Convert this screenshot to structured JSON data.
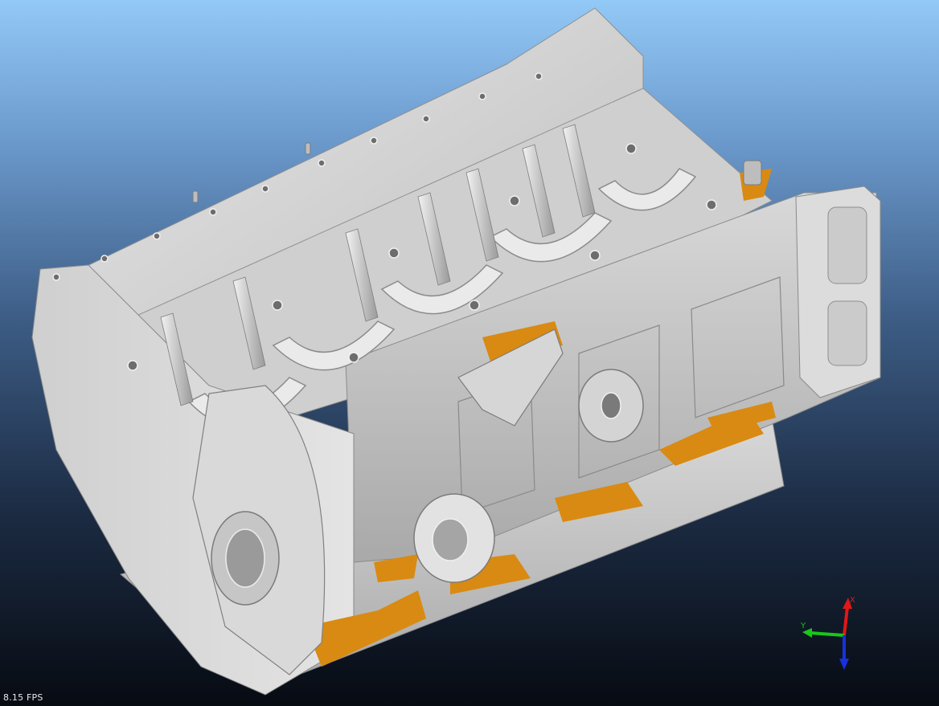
{
  "viewer": {
    "model": "engine-block-scan",
    "background_top": "#93c9f6",
    "background_bottom": "#070b12",
    "surface_color": "#d2d2d2",
    "interior_color": "#d98a12"
  },
  "status": {
    "fps_text": "8.15 FPS"
  },
  "axes": {
    "x_label": "X",
    "y_label": "Y",
    "x_color": "#e01818",
    "y_color": "#18c818",
    "z_color": "#1830e0"
  }
}
